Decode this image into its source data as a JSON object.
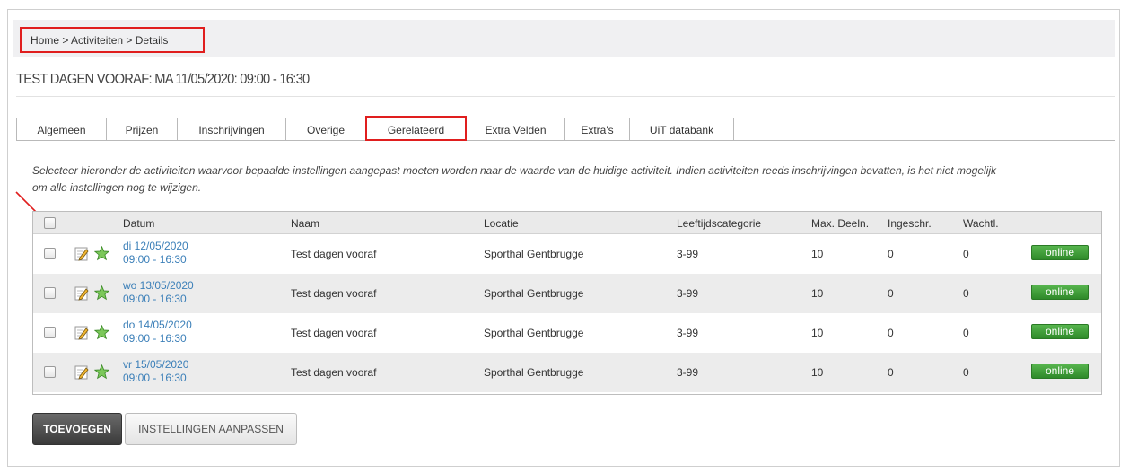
{
  "breadcrumb": "Home > Activiteiten > Details",
  "page_title": "TEST DAGEN VOORAF: MA 11/05/2020: 09:00 - 16:30",
  "tabs": [
    {
      "label": "Algemeen"
    },
    {
      "label": "Prijzen"
    },
    {
      "label": "Inschrijvingen"
    },
    {
      "label": "Overige"
    },
    {
      "label": "Gerelateerd"
    },
    {
      "label": "Extra Velden"
    },
    {
      "label": "Extra's"
    },
    {
      "label": "UiT databank"
    }
  ],
  "intro_line1": "Selecteer hieronder de activiteiten waarvoor bepaalde instellingen aangepast moeten worden naar de waarde van de huidige activiteit. Indien activiteiten reeds inschrijvingen bevatten, is het niet mogelijk",
  "intro_line2": "om alle instellingen nog te wijzigen.",
  "table": {
    "headers": {
      "datum": "Datum",
      "naam": "Naam",
      "locatie": "Locatie",
      "leeftijd": "Leeftijdscategorie",
      "max": "Max. Deeln.",
      "ingeschr": "Ingeschr.",
      "wachtl": "Wachtl."
    },
    "rows": [
      {
        "date": "di 12/05/2020",
        "time": "09:00 - 16:30",
        "naam": "Test dagen vooraf",
        "locatie": "Sporthal Gentbrugge",
        "leeftijd": "3-99",
        "max": "10",
        "ingeschr": "0",
        "wachtl": "0",
        "status": "online"
      },
      {
        "date": "wo 13/05/2020",
        "time": "09:00 - 16:30",
        "naam": "Test dagen vooraf",
        "locatie": "Sporthal Gentbrugge",
        "leeftijd": "3-99",
        "max": "10",
        "ingeschr": "0",
        "wachtl": "0",
        "status": "online"
      },
      {
        "date": "do 14/05/2020",
        "time": "09:00 - 16:30",
        "naam": "Test dagen vooraf",
        "locatie": "Sporthal Gentbrugge",
        "leeftijd": "3-99",
        "max": "10",
        "ingeschr": "0",
        "wachtl": "0",
        "status": "online"
      },
      {
        "date": "vr 15/05/2020",
        "time": "09:00 - 16:30",
        "naam": "Test dagen vooraf",
        "locatie": "Sporthal Gentbrugge",
        "leeftijd": "3-99",
        "max": "10",
        "ingeschr": "0",
        "wachtl": "0",
        "status": "online"
      }
    ]
  },
  "buttons": {
    "add": "TOEVOEGEN",
    "apply": "INSTELLINGEN AANPASSEN"
  },
  "icons": {
    "edit": "edit-icon",
    "star": "star-icon",
    "annotation_arrow": "red-arrow-icon"
  },
  "colors": {
    "highlight_red": "#e01e1e",
    "link_blue": "#3b7fb8",
    "status_green": "#3a9a33",
    "primary_button": "#4a4a4a"
  }
}
